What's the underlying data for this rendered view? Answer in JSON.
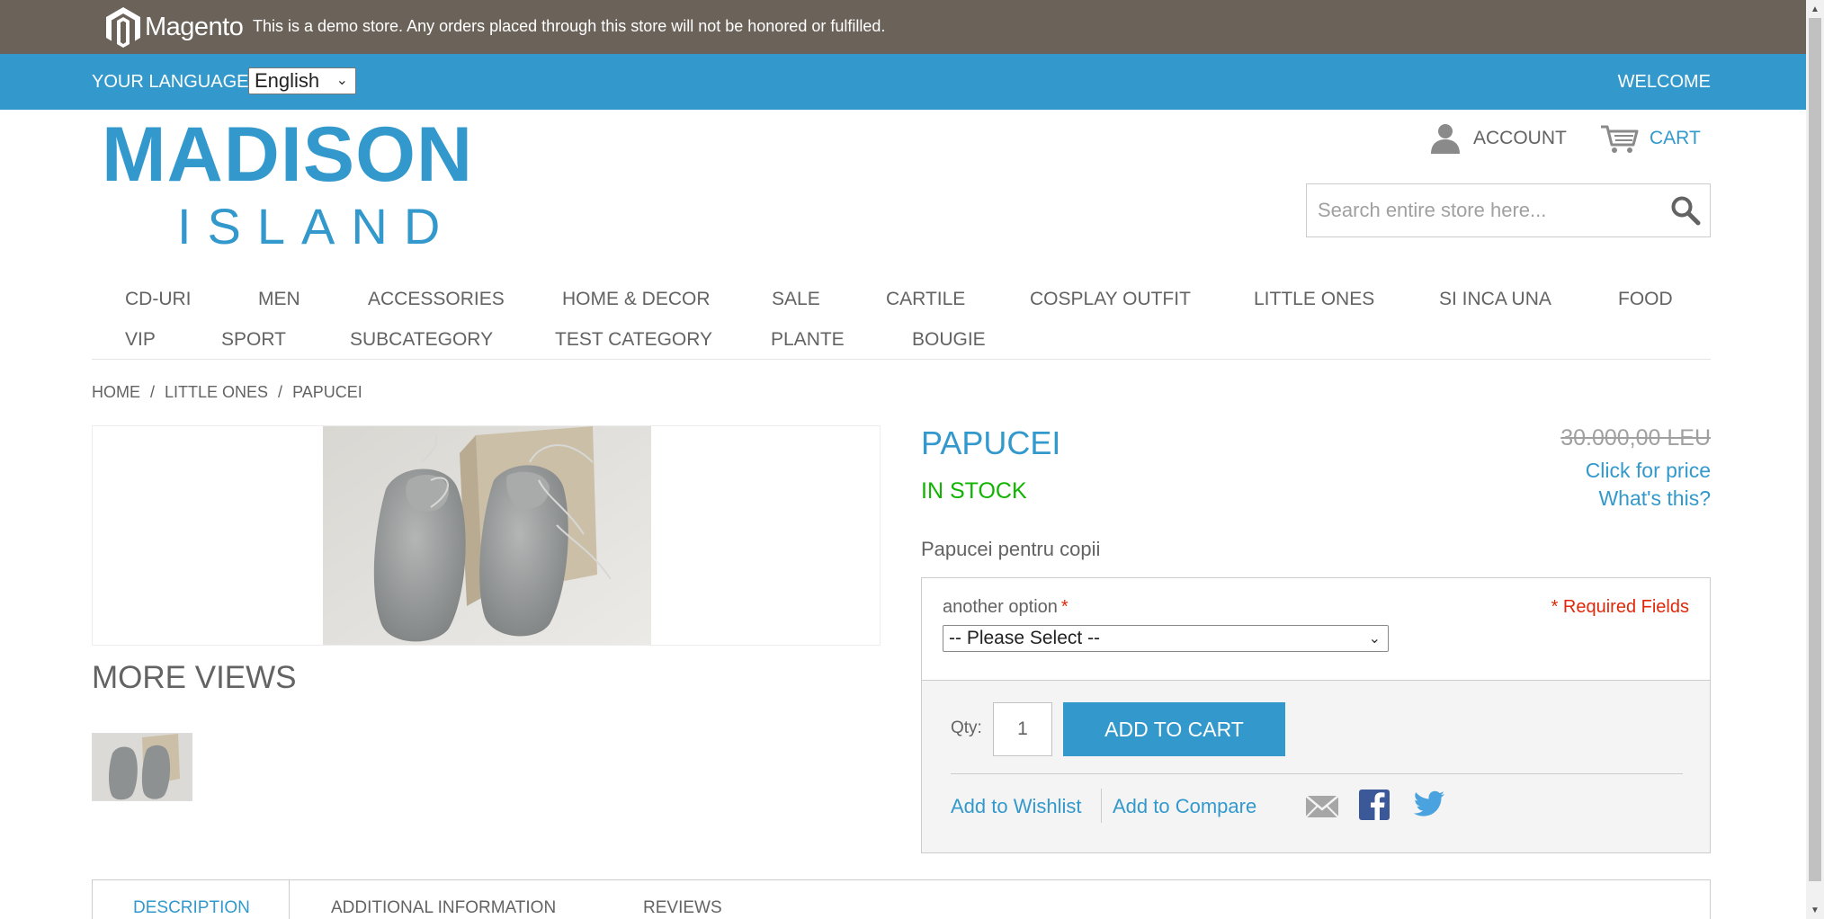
{
  "demo_notice": {
    "brand": "Magento",
    "text": "This is a demo store. Any orders placed through this store will not be honored or fulfilled."
  },
  "language_bar": {
    "label": "Your Language:",
    "selected_language": "English",
    "welcome": "Welcome"
  },
  "header": {
    "logo_top": "MADISON",
    "logo_bottom": "ISLAND",
    "account_label": "Account",
    "cart_label": "Cart",
    "search_placeholder": "Search entire store here..."
  },
  "nav": {
    "items": [
      "CD-URI",
      "MEN",
      "ACCESSORIES",
      "HOME & DECOR",
      "SALE",
      "CARTILE",
      "COSPLAY OUTFIT",
      "LITTLE ONES",
      "SI INCA UNA",
      "FOOD",
      "VIP",
      "SPORT",
      "SUBCATEGORY",
      "TEST CATEGORY",
      "PLANTE",
      "BOUGIE"
    ]
  },
  "breadcrumb": {
    "items": [
      "Home",
      "Little Ones",
      "Papucei"
    ],
    "separator": "/"
  },
  "gallery": {
    "more_views": "More Views"
  },
  "product": {
    "name": "Papucei",
    "old_price": "30.000,00 LEU",
    "click_for_price": "Click for price",
    "whats_this": "What's this?",
    "availability": "In stock",
    "short_description": "Papucei pentru copii",
    "option_label": "another option",
    "required_star": "*",
    "required_fields": "* Required Fields",
    "option_select_value": "-- Please Select --",
    "qty_label": "Qty:",
    "qty_value": "1",
    "add_to_cart": "Add to Cart",
    "add_to_wishlist": "Add to Wishlist",
    "add_to_compare": "Add to Compare"
  },
  "tabs": {
    "items": [
      "Description",
      "Additional Information",
      "Reviews"
    ]
  },
  "colors": {
    "brand_blue": "#3399cc",
    "demo_bar": "#6b6359",
    "in_stock_green": "#11b400",
    "required_red": "#df280a"
  }
}
